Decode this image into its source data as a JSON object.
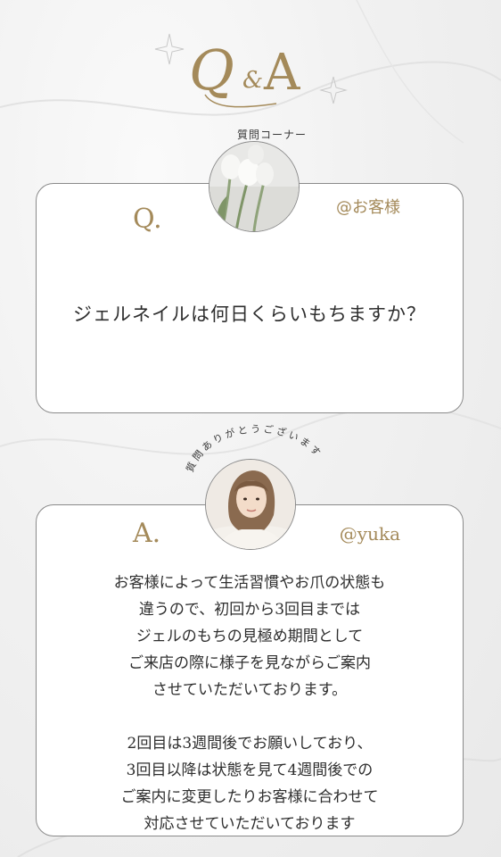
{
  "header": {
    "q_letter": "Q",
    "amp": "&",
    "a_letter": "A",
    "subtitle": "質問コーナー",
    "sparkle_icon": "sparkle-icon"
  },
  "question": {
    "badge": "Q.",
    "handle": "@お客様",
    "text": "ジェルネイルは何日くらいもちますか？",
    "avatar": "tulip-photo"
  },
  "answer": {
    "badge": "A.",
    "handle": "@yuka",
    "arc_caption": "質問ありがとうございます",
    "avatar": "staff-photo",
    "paragraph1": [
      "お客様によって生活習慣やお爪の状態も",
      "違うので、初回から3回目までは",
      "ジェルのもちの見極め期間として",
      "ご来店の際に様子を見ながらご案内",
      "させていただいております。"
    ],
    "paragraph2": [
      "2回目は3週間後でお願いしており、",
      "3回目以降は状態を見て4週間後での",
      "ご案内に変更したりお客様に合わせて",
      "対応させていただいております"
    ]
  },
  "colors": {
    "accent": "#a48a5a",
    "border": "#8a8a8a",
    "text": "#2e2e2e"
  }
}
